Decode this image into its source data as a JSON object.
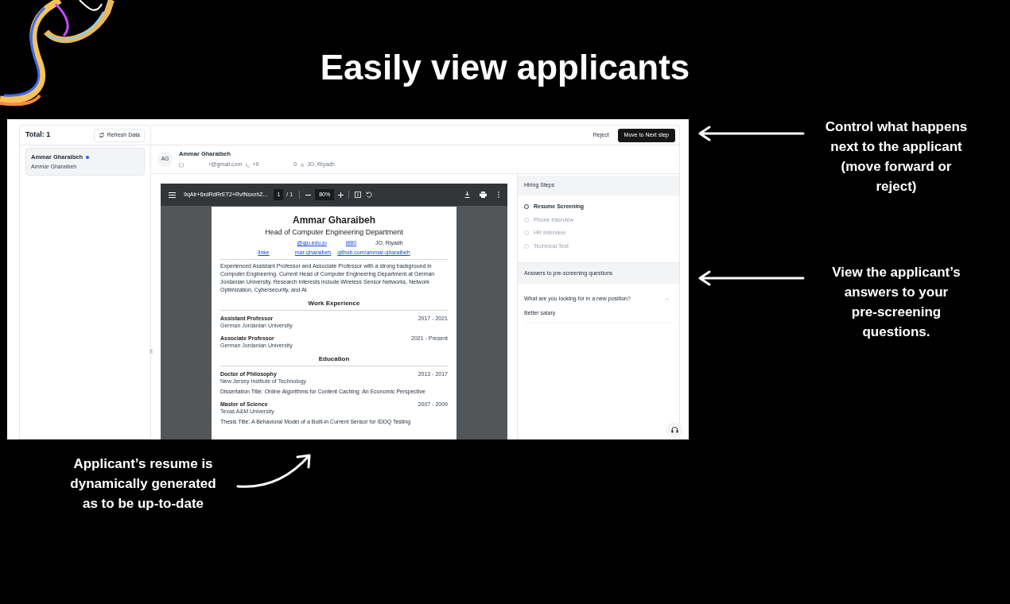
{
  "headline": "Easily view applicants",
  "callouts": [
    {
      "text": "Control what happens next to the applicant (move forward or reject)",
      "kind": "right"
    },
    {
      "text": "View the applicant’s answers to your pre-screening questions.",
      "kind": "right"
    },
    {
      "text": "Applicant’s resume is dynamically generated as to be up-to-date",
      "kind": "bottom"
    }
  ],
  "app": {
    "sidebar": {
      "total": "Total: 1",
      "refresh": "Refresh Data",
      "applicants": [
        {
          "name": "Ammar Gharaibeh",
          "subtitle": "Ammar Gharaibeh",
          "selected": true,
          "unread": true
        }
      ]
    },
    "actions": [
      {
        "label": "Reject",
        "kind": "text"
      },
      {
        "label": "Move to Next step",
        "kind": "primary"
      }
    ],
    "applicant": {
      "initials": "AG",
      "name": "Ammar Gharaibeh",
      "details": [
        {
          "kind": "email",
          "text": "r@gmail.com"
        },
        {
          "kind": "phone",
          "text": "+9"
        },
        {
          "kind": "plain",
          "text": "0"
        },
        {
          "kind": "location",
          "text": "JO, Riyadh"
        }
      ]
    },
    "pdf": {
      "file": "9qAlr+6xdRdRrET2+RvfNsxnhZ...",
      "page": "1",
      "pages": "/ 1",
      "zoom": "80%"
    },
    "resume": {
      "name": "Ammar Gharaibeh",
      "title": "Head of Computer Engineering Department",
      "contact_lines": [
        [
          {
            "text": "@gju.edu.jo",
            "link": true
          },
          {
            "text": "i880",
            "link": true
          },
          {
            "text": "JO, Riyadh",
            "link": false
          }
        ],
        [
          {
            "text": "linke",
            "link": true
          },
          {
            "text": "mar-gharaibeh",
            "link": true
          },
          {
            "text": "github.com/ammar-gharaibeh",
            "link": true
          }
        ]
      ],
      "summary": "Experienced Assistant Professor and Associate Professor with a strong background in Computer Engineering. Current Head of Computer Engineering Department at German Jordanian University. Research interests include Wireless Sensor Networks, Network Optimization, Cybersecurity, and AI.",
      "sections": [
        {
          "heading": "Work Experience",
          "entries": [
            {
              "title": "Assistant Professor",
              "dates": "2017 - 2021",
              "place": "German Jordanian University"
            },
            {
              "title": "Associate Professor",
              "dates": "2021 - Present",
              "place": "German Jordanian University"
            }
          ]
        },
        {
          "heading": "Education",
          "entries": [
            {
              "title": "Doctor of Philosophy",
              "dates": "2013 - 2017",
              "place": "New Jersey Institute of Technology",
              "note": "Dissertation Title: Online Algorithms for Content Caching: An Economic Perspective"
            },
            {
              "title": "Master of Science",
              "dates": "2007 - 2009",
              "place": "Texas A&M University",
              "note": "Thesis Title: A Behavioral Model of a Built-in Current Sensor for IDDQ Testing"
            }
          ]
        }
      ]
    },
    "steps": {
      "title": "Hiring Steps",
      "items": [
        {
          "label": "Resume Screening",
          "active": true
        },
        {
          "label": "Phone Interview",
          "active": false
        },
        {
          "label": "HR Interview",
          "active": false
        },
        {
          "label": "Technical Test",
          "active": false
        }
      ]
    },
    "questions": {
      "title": "Answers to pre-screening questions",
      "items": [
        {
          "question": "What are you looking for in a new position?",
          "answer": "Better salary",
          "expanded": true
        }
      ]
    }
  }
}
